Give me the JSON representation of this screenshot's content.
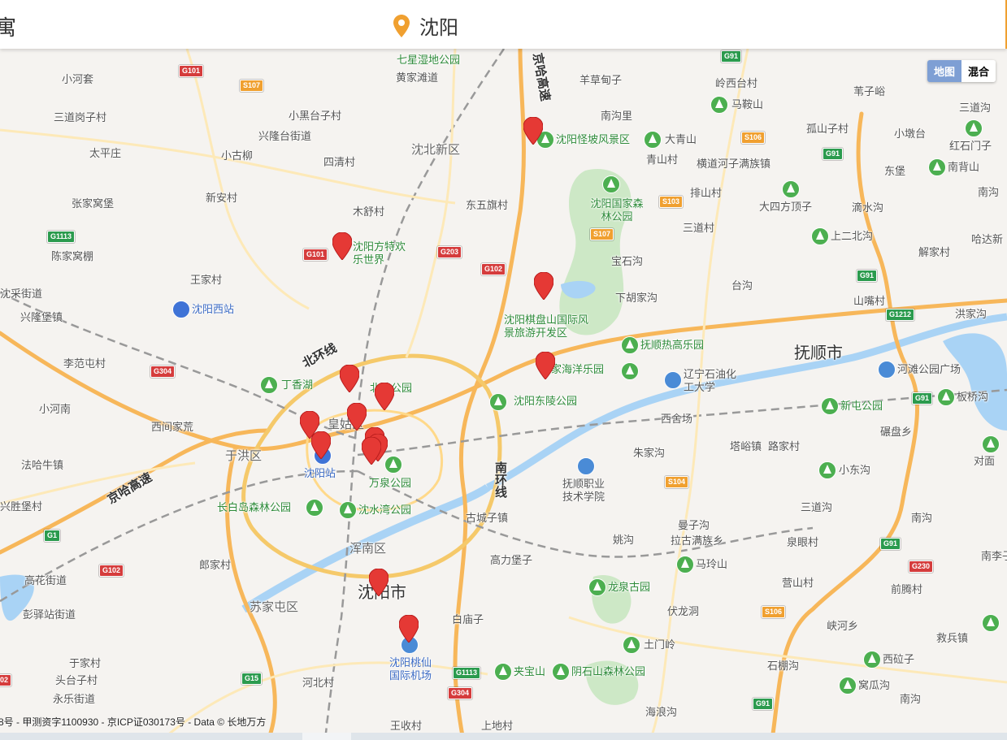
{
  "header": {
    "left_partial_text": "寓",
    "location_label": "沈阳"
  },
  "map_type": {
    "map": "地图",
    "hybrid": "混合"
  },
  "copyright": "8号 - 甲测资字1100930 - 京ICP证030173号 - Data © 长地万方",
  "labels": {
    "qixing": "七星湿地公园",
    "huangjiatan": "黄家滩道",
    "jingha_n": "京哈高速",
    "yangcaodian": "羊草甸子",
    "linxi": "岭西台村",
    "digouzi": "苇子峪",
    "xiaohetao": "小河套",
    "sandaogangzi": "三道岗子村",
    "xiaoheitaizi": "小黑台子村",
    "xinglongtai": "兴隆台街道",
    "shenbeixinqu": "沈北新区",
    "taiping": "太平庄",
    "xiaogulium": "小古柳",
    "siqing": "四清村",
    "maanshan": "马鞍山",
    "nangouli": "南沟里",
    "guaipo": "沈阳怪坡风景区",
    "daqingshan": "大青山",
    "qingshancun": "青山村",
    "gushan": "孤山子村",
    "xiaodunshan": "小墩台",
    "sandaogou_ne": "三道沟",
    "hongshi": "红石门子",
    "nanbeishan": "南背山",
    "hengdao": "横道河子满族镇",
    "dongpu": "东堡",
    "zhangjiawo": "张家窝堡",
    "xinan": "新安村",
    "mushu": "木舒村",
    "dongwuqi": "东五旗村",
    "forest_park": "沈阳国家森林公园",
    "paishan": "排山村",
    "dasifang": "大四方顶子",
    "dishui": "滴水沟",
    "nangou_e": "南沟",
    "sandaocun": "三道村",
    "shangerbei": "上二北沟",
    "hadaxin": "哈达新",
    "chenjiawo": "陈家窝棚",
    "fangte": "沈阳方特欢乐世界",
    "baoshi": "宝石沟",
    "xiejia": "解家村",
    "wangjia": "王家村",
    "shencai": "沈采街道",
    "shenyangxi": "沈阳西站",
    "qipanshan": "沈阳棋盘山国际风景旅游开发区",
    "xiahu": "下胡家沟",
    "taian": "台沟",
    "shangcun": "山嘴村",
    "hongjiagou": "洪家沟",
    "xinglongpu": "兴隆堡镇",
    "beihuan": "北环线",
    "redegarden": "抚顺热高乐园",
    "fushun": "抚顺市",
    "lifantun": "李范屯村",
    "dingxiang": "丁香湖",
    "beiling": "北陵公园",
    "ocean": "家海洋乐园",
    "liaoning_univ": "辽宁石油化工大学",
    "hebin": "河滩公园广场",
    "banqiao": "板桥沟",
    "xiaohenan": "小河南",
    "dongling": "沈阳东陵公园",
    "xintun": "新屯公园",
    "xijiao": "西间家荒",
    "huanggu": "皇姑区",
    "xicang": "西舍场",
    "tayu": "塔峪镇",
    "lujia": "路家村",
    "bopan": "碾盘乡",
    "duimian": "对面",
    "yuhong": "于洪区",
    "shenyangzhan": "沈阳站",
    "wanquan": "万泉公园",
    "zhujia": "朱家沟",
    "fushun_vocational": "抚顺职业技术学院",
    "xiaodonggou": "小东沟",
    "faliu": "法哈牛镇",
    "jingha_w": "京哈高速",
    "nanhuan": "南环线",
    "xingbao": "兴胜堡村",
    "changbaidao": "长白岛森林公园",
    "shenshui": "沈水湾公园",
    "guchengzi": "古城子镇",
    "manghe": "曼子沟",
    "lagu": "拉古满族乡",
    "sandaogou_se": "三道沟",
    "nangou_se": "南沟",
    "yaogou": "姚沟",
    "quanyan": "泉眼村",
    "hunnan": "浑南区",
    "gaoli": "高力堡子",
    "mashan": "马玲山",
    "nanlizi": "南李子",
    "langjia": "郎家村",
    "gaohua": "高花街道",
    "longquan": "龙泉古园",
    "fuling": "伏龙洞",
    "yingshan": "营山村",
    "qianteng": "前腾村",
    "shenyang_city": "沈阳市",
    "sujiatun": "苏家屯区",
    "pengyi": "彭驿站街道",
    "baimiao": "白庙子",
    "xiahe": "峡河乡",
    "jiubing": "救兵镇",
    "taoxian": "沈阳桃仙国际机场",
    "tumenling": "土门岭",
    "xigulizi": "西砬子",
    "yujia": "于家村",
    "toutaizi": "头台子村",
    "jiabao": "夹宝山",
    "yinshishan": "阴石山森林公园",
    "shipeng": "石棚沟",
    "woguagou": "窝瓜沟",
    "yongle": "永乐街道",
    "hebeicun": "河北村",
    "hailanggou": "海浪沟",
    "nangou_s": "南沟",
    "wangshou": "王收村",
    "shangdi": "上地村"
  },
  "shields": {
    "g101a": "G101",
    "s107a": "S107",
    "g91a": "G91",
    "s106": "S106",
    "g91b": "G91",
    "s103": "S103",
    "s107b": "S107",
    "g1113a": "G1113",
    "g101b": "G101",
    "g203": "G203",
    "g102a": "G102",
    "g91c": "G91",
    "g1212": "G1212",
    "g304a": "G304",
    "g91d": "G91",
    "s104": "S104",
    "g1": "G1",
    "g91e": "G91",
    "g230": "G230",
    "g102b": "G102",
    "s106b": "S106",
    "g1113b": "G1113",
    "g15": "G15",
    "g304b": "G304",
    "g91f": "G91",
    "g02": "02"
  },
  "colors": {
    "accent": "#f0a030",
    "marker": "#e53935",
    "poi": "#4caf50",
    "water": "#a9d3f5",
    "park": "#bfe3b8"
  }
}
